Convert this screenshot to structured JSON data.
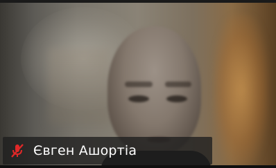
{
  "participant": {
    "name": "Євген Ашортіа",
    "mic_icon": "mic-muted-icon",
    "mic_color": "#e02828"
  },
  "tile": {
    "label_background": "#1e1e1e",
    "label_text_color": "#ffffff"
  }
}
